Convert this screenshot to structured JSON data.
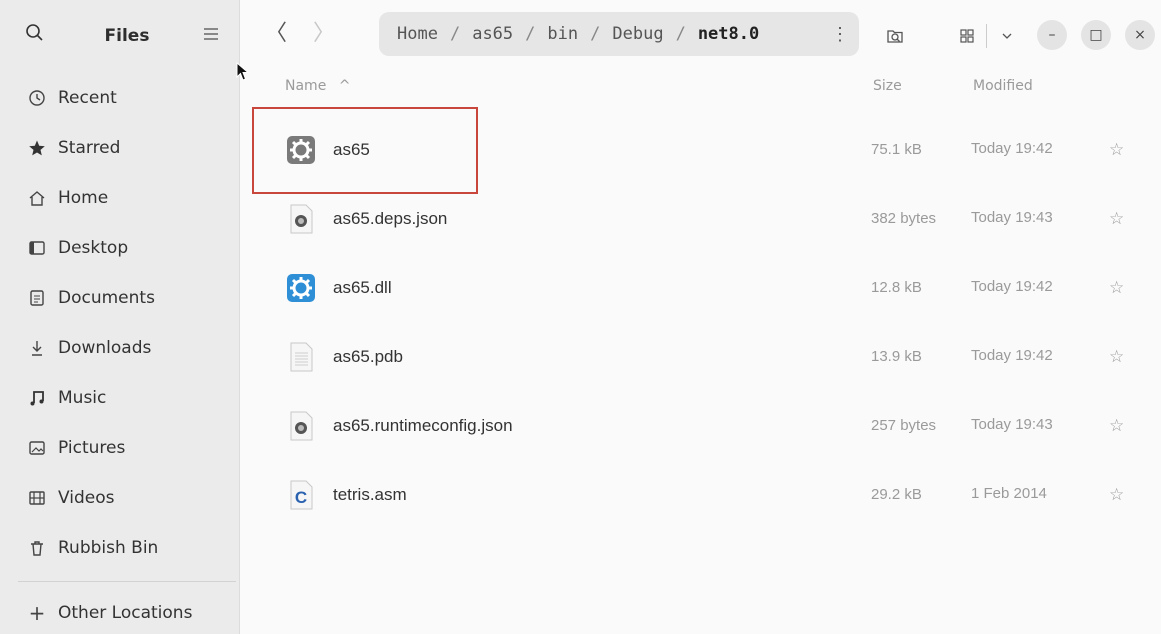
{
  "sidebar": {
    "title": "Files",
    "search_icon": "search-icon",
    "menu_icon": "hamburger-icon",
    "items": [
      {
        "label": "Recent",
        "icon": "clock-icon"
      },
      {
        "label": "Starred",
        "icon": "star-icon"
      },
      {
        "label": "Home",
        "icon": "home-icon"
      },
      {
        "label": "Desktop",
        "icon": "desktop-icon"
      },
      {
        "label": "Documents",
        "icon": "document-icon"
      },
      {
        "label": "Downloads",
        "icon": "download-icon"
      },
      {
        "label": "Music",
        "icon": "music-icon"
      },
      {
        "label": "Pictures",
        "icon": "picture-icon"
      },
      {
        "label": "Videos",
        "icon": "film-icon"
      },
      {
        "label": "Rubbish Bin",
        "icon": "trash-icon"
      }
    ],
    "other_locations": "Other Locations"
  },
  "toolbar": {
    "back_glyph": "〈",
    "forward_glyph": "〉",
    "path": [
      {
        "label": "Home"
      },
      {
        "label": "as65"
      },
      {
        "label": "bin"
      },
      {
        "label": "Debug"
      },
      {
        "label": "net8.0"
      }
    ],
    "path_separator": "/",
    "path_menu": "⋮",
    "search_icon": "search-folder-icon",
    "view_icon": "grid-view-icon",
    "view_dropdown_icon": "chevron-down-icon",
    "min_label": "–",
    "max_label": "□",
    "close_label": "×"
  },
  "columns": {
    "name": "Name",
    "sort_icon": "^",
    "size": "Size",
    "modified": "Modified"
  },
  "files": [
    {
      "name": "as65",
      "size": "75.1 kB",
      "modified": "Today 19:42",
      "icon": "executable-gear-icon"
    },
    {
      "name": "as65.deps.json",
      "size": "382 bytes",
      "modified": "Today 19:43",
      "icon": "json-file-icon"
    },
    {
      "name": "as65.dll",
      "size": "12.8 kB",
      "modified": "Today 19:42",
      "icon": "dll-gear-icon"
    },
    {
      "name": "as65.pdb",
      "size": "13.9 kB",
      "modified": "Today 19:42",
      "icon": "text-file-icon"
    },
    {
      "name": "as65.runtimeconfig.json",
      "size": "257 bytes",
      "modified": "Today 19:43",
      "icon": "json-file-icon"
    },
    {
      "name": "tetris.asm",
      "size": "29.2 kB",
      "modified": "1 Feb 2014",
      "icon": "c-source-file-icon"
    }
  ],
  "star_glyph": "☆",
  "colors": {
    "highlight": "#c9463d",
    "dll_icon": "#2f8fd6",
    "sidebar_bg": "#ebebeb",
    "content_bg": "#fafafa"
  }
}
